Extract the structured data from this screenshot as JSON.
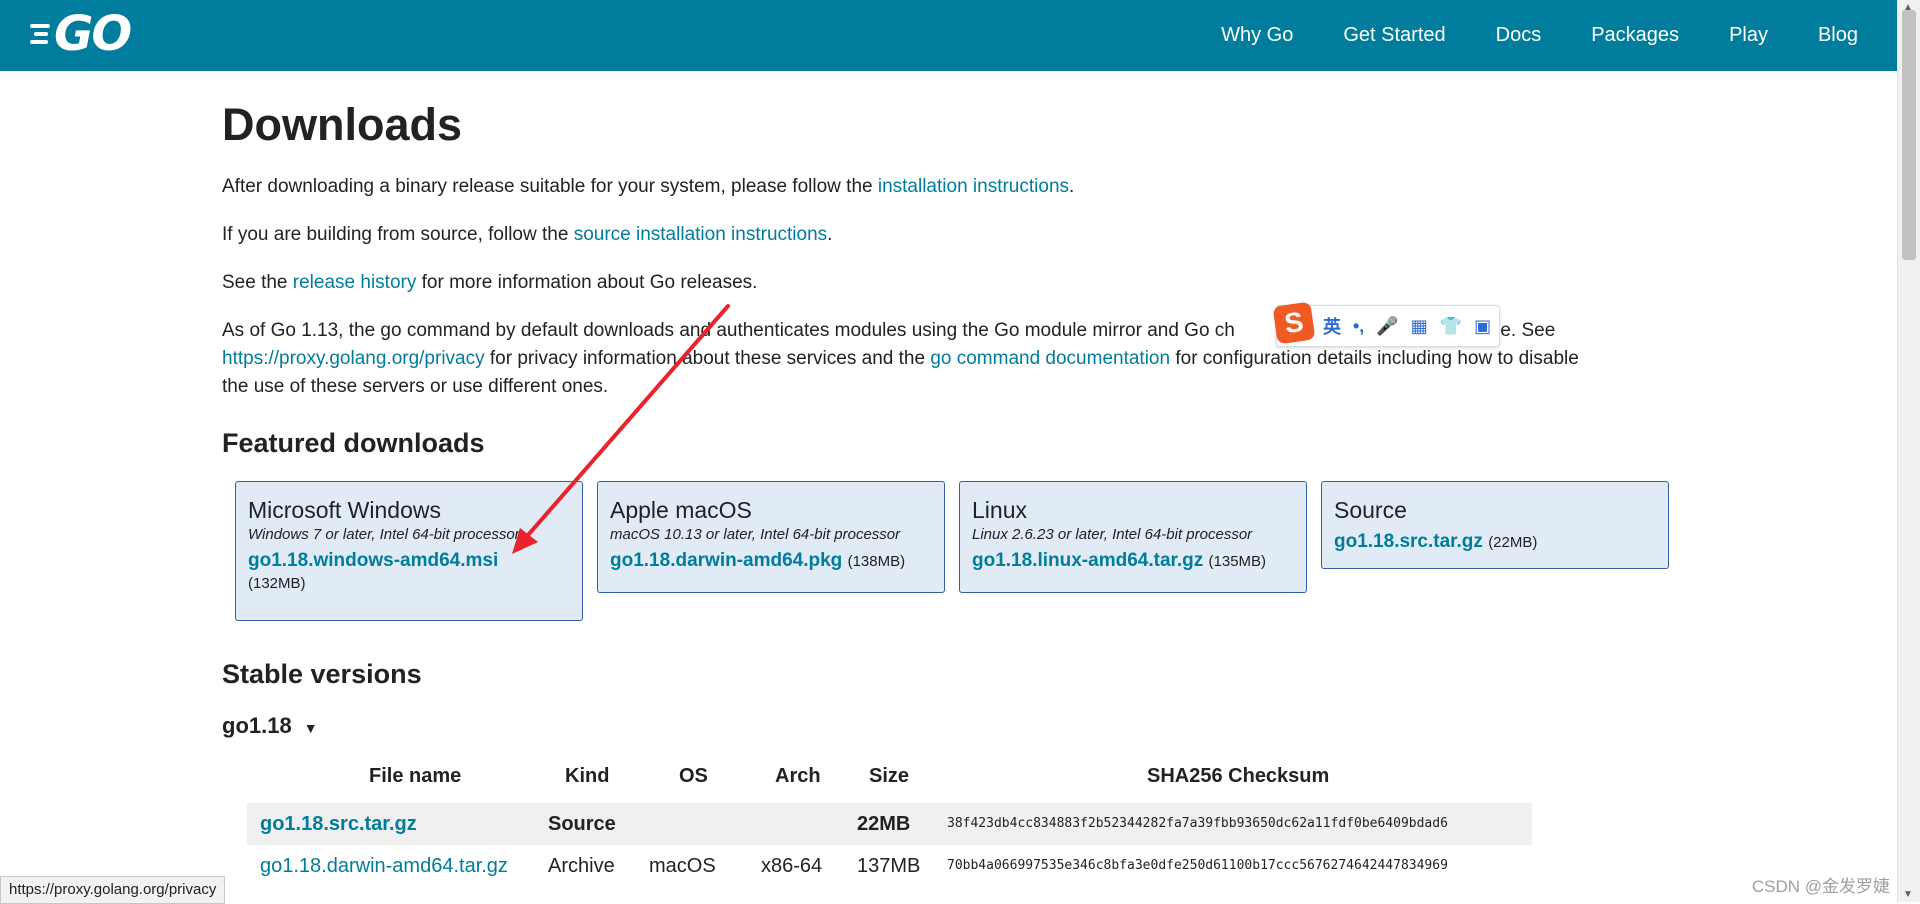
{
  "header": {
    "logo_text": "GO",
    "nav": [
      "Why Go",
      "Get Started",
      "Docs",
      "Packages",
      "Play",
      "Blog"
    ]
  },
  "page": {
    "title": "Downloads",
    "p1": {
      "before": "After downloading a binary release suitable for your system, please follow the ",
      "link": "installation instructions",
      "after": "."
    },
    "p2": {
      "before": "If you are building from source, follow the ",
      "link": "source installation instructions",
      "after": "."
    },
    "p3": {
      "before": "See the ",
      "link": "release history",
      "after": " for more information about Go releases."
    },
    "p4": {
      "line1": "As of Go 1.13, the go command by default downloads and authenticates modules using the Go module mirror and Go ch",
      "line1_tail": "y Google. See",
      "link1": "https://proxy.golang.org/privacy",
      "mid": " for privacy information about these services and the ",
      "link2": "go command documentation",
      "after": " for configuration details including how to disable",
      "line3": "the use of these servers or use different ones."
    },
    "featured_heading": "Featured downloads",
    "stable_heading": "Stable versions",
    "version": "go1.18",
    "version_caret": "▼"
  },
  "featured": [
    {
      "platform": "Microsoft Windows",
      "req": "Windows 7 or later, Intel 64-bit processor",
      "file": "go1.18.windows-amd64.msi",
      "size": "(132MB)"
    },
    {
      "platform": "Apple macOS",
      "req": "macOS 10.13 or later, Intel 64-bit processor",
      "file": "go1.18.darwin-amd64.pkg",
      "size": "(138MB)"
    },
    {
      "platform": "Linux",
      "req": "Linux 2.6.23 or later, Intel 64-bit processor",
      "file": "go1.18.linux-amd64.tar.gz",
      "size": "(135MB)"
    },
    {
      "platform": "Source",
      "req": "",
      "file": "go1.18.src.tar.gz",
      "size": "(22MB)"
    }
  ],
  "table": {
    "headers": [
      "File name",
      "Kind",
      "OS",
      "Arch",
      "Size",
      "SHA256 Checksum"
    ],
    "rows": [
      [
        "go1.18.src.tar.gz",
        "Source",
        "",
        "",
        "22MB",
        "38f423db4cc834883f2b52344282fa7a39fbb93650dc62a11fdf0be6409bdad6"
      ],
      [
        "go1.18.darwin-amd64.tar.gz",
        "Archive",
        "macOS",
        "x86-64",
        "137MB",
        "70bb4a066997535e346c8bfa3e0dfe250d61100b17ccc5676274642447834969"
      ]
    ]
  },
  "ime": {
    "logo": "S",
    "tools": [
      "英",
      "•,",
      "🎤",
      "▦",
      "👕",
      "▣"
    ]
  },
  "status_url": "https://proxy.golang.org/privacy",
  "watermark": "CSDN @金发罗婕",
  "colors": {
    "header": "#007d9c",
    "link": "#007d9c",
    "card_bg": "#e0ebf5",
    "card_border": "#375eab",
    "arrow": "#e8232b"
  }
}
